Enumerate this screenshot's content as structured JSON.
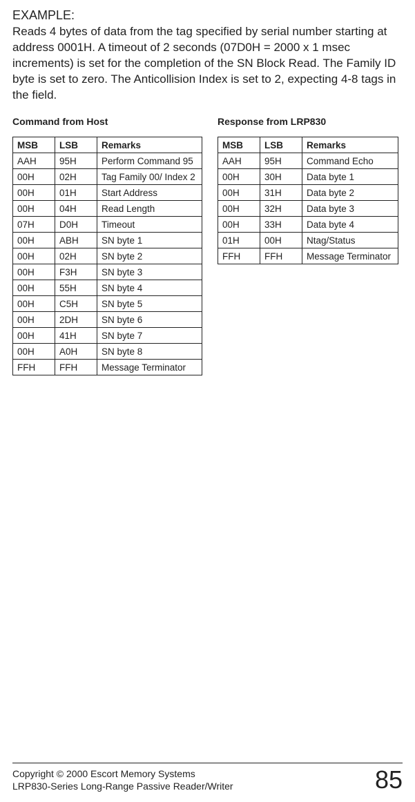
{
  "example": {
    "heading": "EXAMPLE:",
    "body": "Reads 4 bytes of data from the tag specified by serial number starting at address 0001H. A timeout of 2 seconds (07D0H = 2000 x 1 msec increments) is set for the completion of the SN Block Read. The Family ID byte is set to zero.  The Anticollision Index is set to 2, expecting 4-8 tags in the field."
  },
  "left": {
    "title": "Command from Host",
    "headers": {
      "msb": "MSB",
      "lsb": "LSB",
      "remarks": "Remarks"
    },
    "rows": [
      {
        "msb": "AAH",
        "lsb": "95H",
        "remarks": "Perform Command 95"
      },
      {
        "msb": "00H",
        "lsb": "02H",
        "remarks": "Tag Family 00/ Index 2"
      },
      {
        "msb": "00H",
        "lsb": "01H",
        "remarks": "Start Address"
      },
      {
        "msb": "00H",
        "lsb": "04H",
        "remarks": "Read Length"
      },
      {
        "msb": "07H",
        "lsb": "D0H",
        "remarks": "Timeout"
      },
      {
        "msb": "00H",
        "lsb": "ABH",
        "remarks": "SN byte 1"
      },
      {
        "msb": "00H",
        "lsb": "02H",
        "remarks": "SN byte 2"
      },
      {
        "msb": "00H",
        "lsb": "F3H",
        "remarks": "SN byte 3"
      },
      {
        "msb": "00H",
        "lsb": "55H",
        "remarks": "SN byte 4"
      },
      {
        "msb": "00H",
        "lsb": "C5H",
        "remarks": "SN byte 5"
      },
      {
        "msb": "00H",
        "lsb": "2DH",
        "remarks": "SN byte 6"
      },
      {
        "msb": "00H",
        "lsb": "41H",
        "remarks": "SN byte 7"
      },
      {
        "msb": "00H",
        "lsb": "A0H",
        "remarks": "SN byte 8"
      },
      {
        "msb": "FFH",
        "lsb": "FFH",
        "remarks": "Message Terminator"
      }
    ]
  },
  "right": {
    "title": "Response from LRP830",
    "headers": {
      "msb": "MSB",
      "lsb": "LSB",
      "remarks": "Remarks"
    },
    "rows": [
      {
        "msb": "AAH",
        "lsb": "95H",
        "remarks": "Command Echo"
      },
      {
        "msb": "00H",
        "lsb": "30H",
        "remarks": "Data byte 1"
      },
      {
        "msb": "00H",
        "lsb": "31H",
        "remarks": "Data byte 2"
      },
      {
        "msb": "00H",
        "lsb": "32H",
        "remarks": "Data byte 3"
      },
      {
        "msb": "00H",
        "lsb": "33H",
        "remarks": "Data byte 4"
      },
      {
        "msb": "01H",
        "lsb": "00H",
        "remarks": "Ntag/Status"
      },
      {
        "msb": "FFH",
        "lsb": "FFH",
        "remarks": "Message Terminator"
      }
    ]
  },
  "footer": {
    "line1": "Copyright © 2000 Escort Memory Systems",
    "line2": "LRP830-Series Long-Range Passive Reader/Writer",
    "page": "85"
  }
}
